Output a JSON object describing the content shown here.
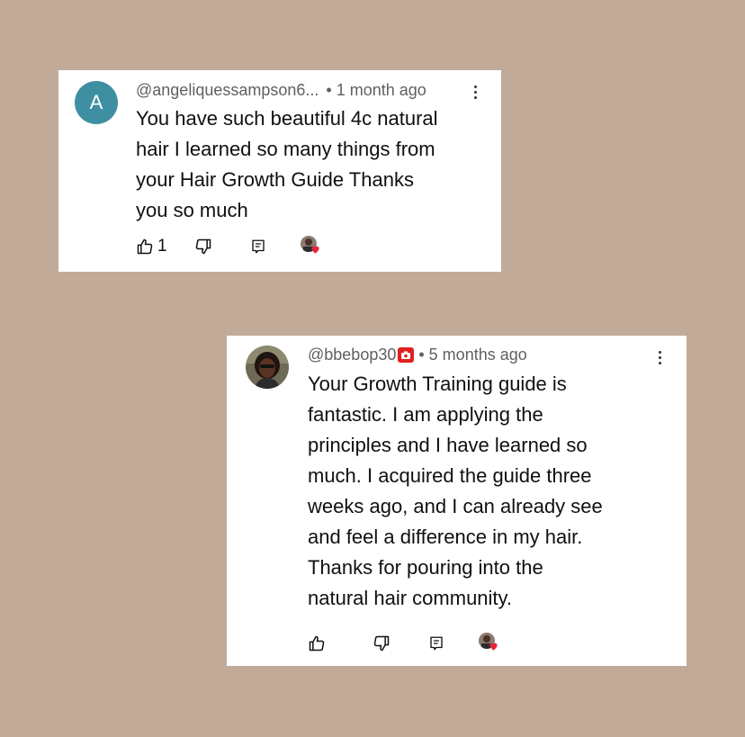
{
  "comments": [
    {
      "avatar_letter": "A",
      "avatar_color": "#3f8fa3",
      "handle": "@angeliquessampson6...",
      "separator": "•",
      "time": "1 month ago",
      "text": "You have such beautiful 4c natural\nhair I learned so many things from\nyour Hair Growth Guide Thanks\nyou so much",
      "like_count": "1",
      "icons": [
        "thumbs-up-icon",
        "thumbs-down-icon",
        "reply-icon",
        "creator-heart-icon",
        "more-vert-icon"
      ]
    },
    {
      "avatar": "user-photo",
      "handle": "@bbebop30",
      "badge_icon": "camera-badge-icon",
      "separator": "•",
      "time": "5 months ago",
      "text": "Your Growth Training guide is\nfantastic. I am applying the\nprinciples and I have learned so\nmuch. I acquired the guide three\nweeks ago, and I can already see\nand feel a difference in my hair.\nThanks for pouring into the\nnatural hair community.",
      "like_count": "",
      "icons": [
        "thumbs-up-icon",
        "thumbs-down-icon",
        "reply-icon",
        "creator-heart-icon",
        "more-vert-icon"
      ]
    }
  ],
  "colors": {
    "background": "#c2aa99",
    "card": "#ffffff",
    "heart": "#e8243c",
    "badge": "#e02020"
  }
}
